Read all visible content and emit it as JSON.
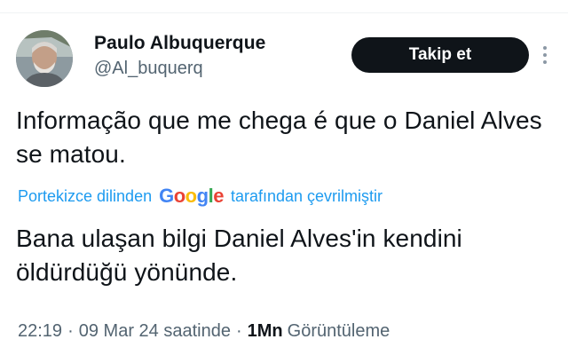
{
  "author": {
    "display_name": "Paulo Albuquerque",
    "handle": "@Al_buquerq"
  },
  "follow_label": "Takip et",
  "tweet": {
    "original_text": "Informação que me chega é que o Daniel Alves se matou.",
    "translated_text": "Bana ulaşan bilgi Daniel Alves'in kendini öldürdüğü yönünde."
  },
  "translation": {
    "prefix": "Portekizce dilinden",
    "provider": "Google",
    "suffix": "tarafından çevrilmiştir"
  },
  "meta": {
    "time": "22:19",
    "date": "09 Mar 24 saatinde",
    "views_count": "1Mn",
    "views_label": "Görüntüleme",
    "separator": "·"
  },
  "icons": {
    "more": "more-vertical-icon"
  },
  "colors": {
    "link_blue": "#1d9bf0",
    "text_primary": "#0f1419",
    "text_secondary": "#536471",
    "button_bg": "#0f1419"
  }
}
